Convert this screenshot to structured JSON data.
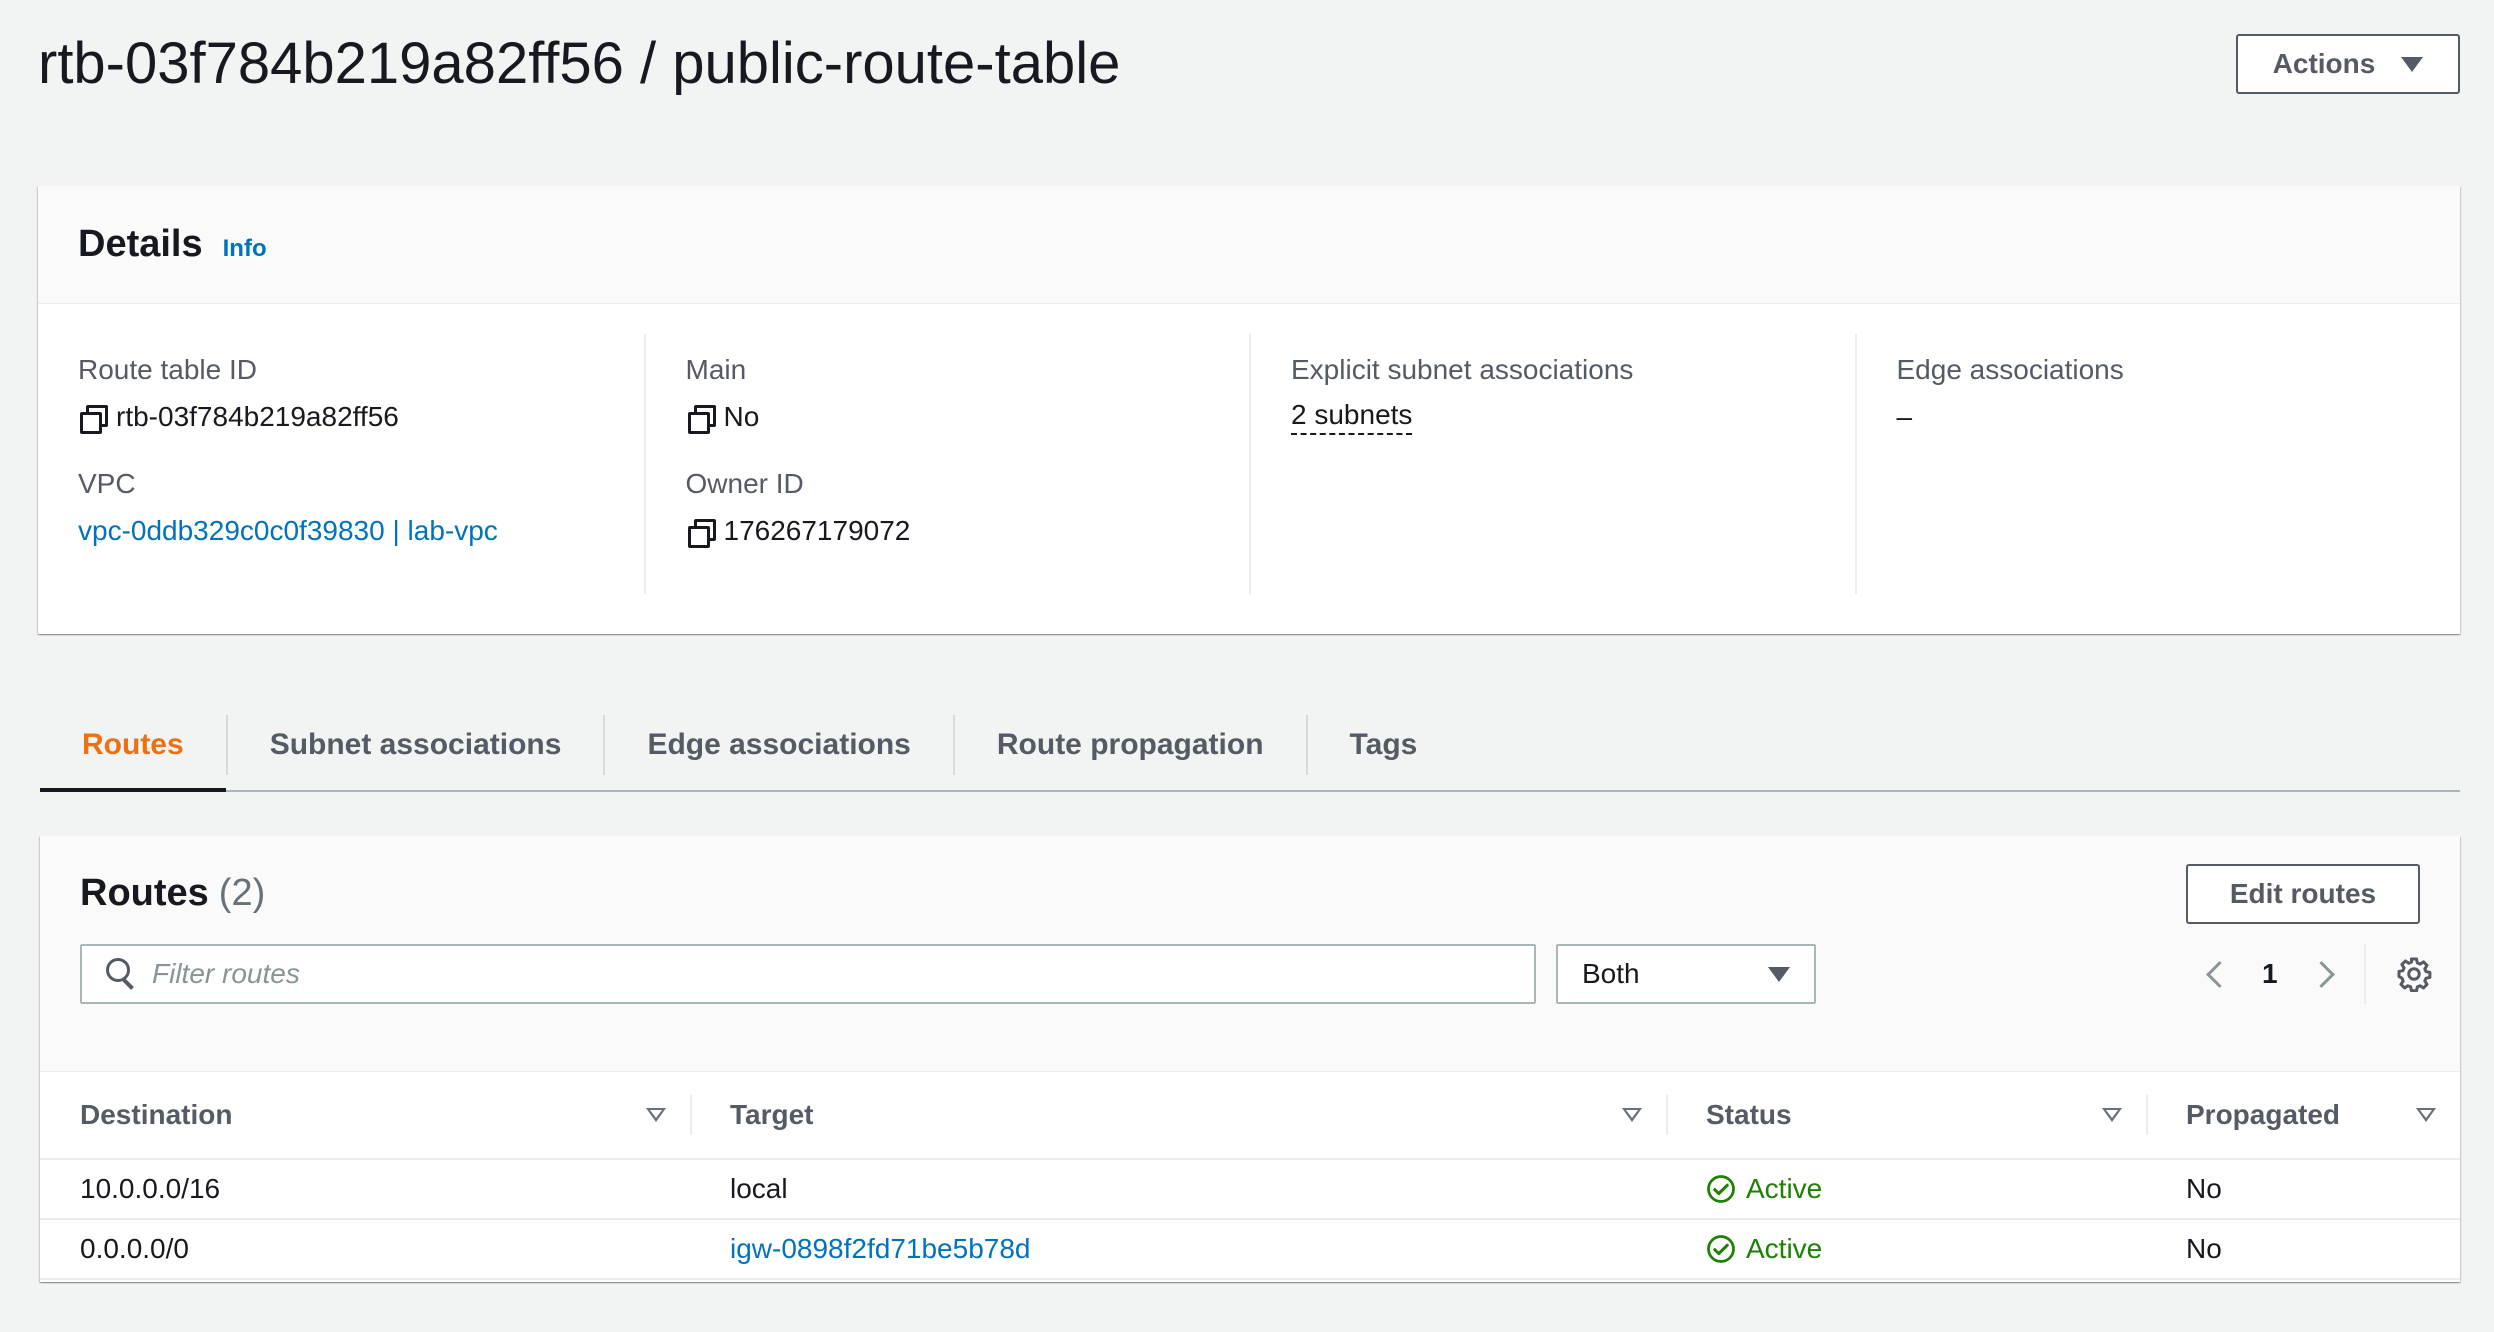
{
  "header": {
    "title": "rtb-03f784b219a82ff56 / public-route-table",
    "actions_label": "Actions"
  },
  "details": {
    "title": "Details",
    "info_label": "Info",
    "route_table_id_label": "Route table ID",
    "route_table_id_value": "rtb-03f784b219a82ff56",
    "vpc_label": "VPC",
    "vpc_value": "vpc-0ddb329c0c0f39830 | lab-vpc",
    "main_label": "Main",
    "main_value": "No",
    "owner_id_label": "Owner ID",
    "owner_id_value": "176267179072",
    "explicit_subnet_label": "Explicit subnet associations",
    "explicit_subnet_value": "2 subnets",
    "edge_assoc_label": "Edge associations",
    "edge_assoc_value": "–"
  },
  "tabs": [
    {
      "label": "Routes",
      "active": true
    },
    {
      "label": "Subnet associations",
      "active": false
    },
    {
      "label": "Edge associations",
      "active": false
    },
    {
      "label": "Route propagation",
      "active": false
    },
    {
      "label": "Tags",
      "active": false
    }
  ],
  "routes": {
    "title": "Routes",
    "count": "(2)",
    "edit_label": "Edit routes",
    "filter_placeholder": "Filter routes",
    "select_value": "Both",
    "page_number": "1",
    "columns": [
      "Destination",
      "Target",
      "Status",
      "Propagated"
    ],
    "rows": [
      {
        "destination": "10.0.0.0/16",
        "target": "local",
        "target_is_link": false,
        "status": "Active",
        "propagated": "No"
      },
      {
        "destination": "0.0.0.0/0",
        "target": "igw-0898f2fd71be5b78d",
        "target_is_link": true,
        "status": "Active",
        "propagated": "No"
      }
    ]
  },
  "colors": {
    "link": "#0073bb",
    "active_tab": "#ec7211",
    "status_active": "#1d8102",
    "background": "#f2f3f3"
  },
  "icons": [
    "caret-down-icon",
    "copy-icon",
    "search-icon",
    "chevron-left-icon",
    "chevron-right-icon",
    "gear-icon",
    "sort-icon",
    "check-circle-icon"
  ]
}
